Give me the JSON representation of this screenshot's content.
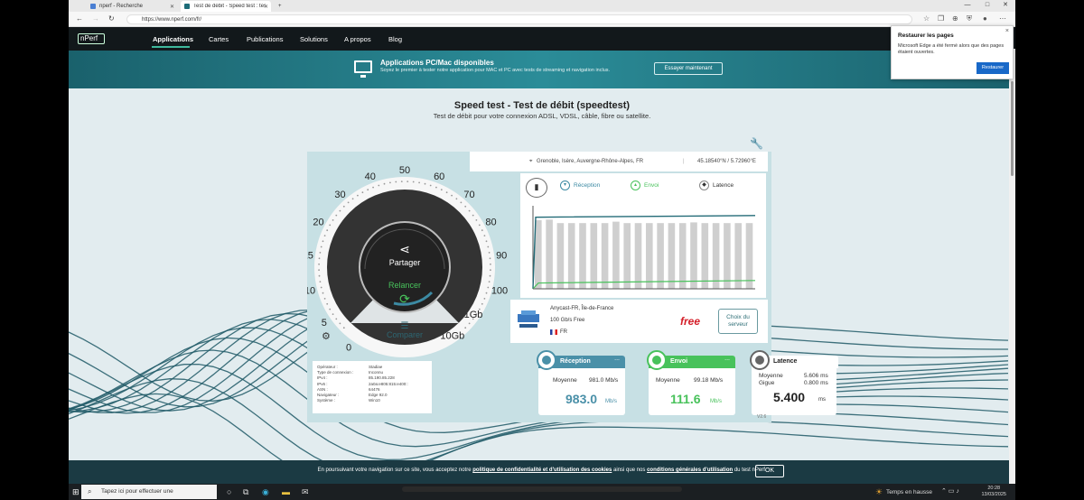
{
  "browser": {
    "tabs": [
      {
        "label": "nperf - Recherche"
      },
      {
        "label": "Test de débit - Speed test : testez..."
      }
    ],
    "url": "https://www.nperf.com/fr/"
  },
  "popup": {
    "title": "Restaurer les pages",
    "message": "Microsoft Edge a été fermé alors que des pages étaient ouvertes.",
    "button": "Restaurer",
    "close": "×"
  },
  "site": {
    "logo": "nPerf",
    "nav": [
      "Applications",
      "Cartes",
      "Publications",
      "Solutions",
      "A propos",
      "Blog"
    ],
    "banner": {
      "title": "Applications PC/Mac disponibles",
      "text": "Soyez le premier à tester notre application pour MAC et PC avec tests de streaming et navigation inclus.",
      "button": "Essayer maintenant"
    },
    "title": "Speed test - Test de débit (speedtest)",
    "subtitle": "Test de débit pour votre connexion ADSL, VDSL, câble, fibre ou satellite.",
    "location": "Grenoble, Isère, Auvergne-Rhône-Alpes, FR",
    "coords": "45.18540°N / 5.72960°E",
    "gauge": {
      "ticks": [
        "0",
        "5",
        "10",
        "15",
        "20",
        "30",
        "40",
        "50",
        "60",
        "70",
        "80",
        "90",
        "100",
        "1Gb",
        "10Gb"
      ],
      "share": "Partager",
      "restart": "Relancer",
      "compare": "Comparer"
    },
    "legend": {
      "reception": "Réception",
      "envoi": "Envoi",
      "latence": "Latence"
    },
    "server": {
      "name": "Anycast-FR, Île-de-France",
      "capacity": "100 Gb/s Free",
      "country": "FR",
      "brand": "free",
      "choose": "Choix du serveur"
    },
    "sysinfo": [
      [
        "Opérateur :",
        "Stadiae"
      ],
      [
        "Type de connexion :",
        "Inconnu"
      ],
      [
        "IPv4 :",
        "85.190.85.228"
      ],
      [
        "IPv6 :",
        "2a0a:e805:815:e400::"
      ],
      [
        "ASN :",
        "64476"
      ],
      [
        "Navigateur :",
        "Edge 92.0"
      ],
      [
        "Système :",
        "Win10"
      ]
    ],
    "results": {
      "reception": {
        "title": "Réception",
        "avg_label": "Moyenne",
        "avg": "981.0 Mb/s",
        "big": "983.0",
        "unit": "Mb/s",
        "color": "#4a90a8"
      },
      "envoi": {
        "title": "Envoi",
        "avg_label": "Moyenne",
        "avg": "99.18 Mb/s",
        "big": "111.6",
        "unit": "Mb/s",
        "color": "#48c25b"
      },
      "latence": {
        "title": "Latence",
        "avg_label": "Moyenne",
        "avg": "5.606 ms",
        "jitter_label": "Gigue",
        "jitter": "0.800 ms",
        "big": "5.400",
        "unit": "ms",
        "color": "#555555"
      }
    },
    "version": "V2.6",
    "cookie": {
      "pre": "En poursuivant votre navigation sur ce site, vous acceptez notre ",
      "link1": "politique de confidentialité et d'utilisation des cookies",
      "mid": " ainsi que nos ",
      "link2": "conditions générales d'utilisation",
      "post": " du test nPerf.",
      "ok": "OK"
    }
  },
  "chart_data": {
    "type": "bar",
    "bars": [
      0.96,
      0.97,
      0.92,
      0.92,
      0.92,
      0.92,
      0.92,
      0.94,
      0.92,
      0.92,
      0.92,
      0.92,
      0.92,
      0.92,
      0.93,
      0.92,
      0.92,
      0.92,
      0.92,
      0.92
    ],
    "reception_line": 0.98,
    "envoi_line": 0.1
  },
  "taskbar": {
    "search": "Tapez ici pour effectuer une",
    "weather": "Temps en hausse",
    "time": "20:28",
    "date": "13/03/2025"
  }
}
